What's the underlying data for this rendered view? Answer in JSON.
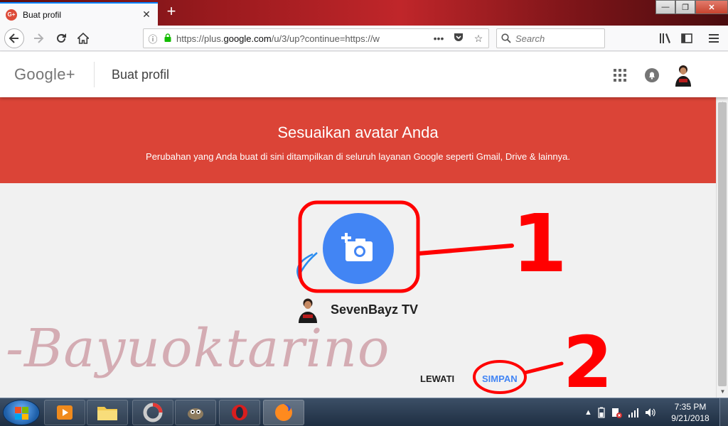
{
  "browser": {
    "tab_title": "Buat profil",
    "tab_favicon": "G+",
    "tab_close": "✕",
    "new_tab": "+",
    "url_domain_prefix": "https://plus.",
    "url_domain": "google.com",
    "url_path": "/u/3/up?continue=https://w",
    "url_more": "•••",
    "search_placeholder": "Search",
    "window": {
      "minimize": "—",
      "maximize": "❐",
      "close": "✕"
    }
  },
  "gplus": {
    "logo": "Google+",
    "page_title": "Buat profil"
  },
  "banner": {
    "title": "Sesuaikan avatar Anda",
    "subtitle": "Perubahan yang Anda buat di sini ditampilkan di seluruh layanan Google seperti Gmail, Drive & lainnya."
  },
  "profile": {
    "name": "SevenBayz TV"
  },
  "actions": {
    "skip_label": "LEWATI",
    "save_label": "SIMPAN"
  },
  "annotations": {
    "label_1": "1",
    "label_2": "2",
    "watermark": "-Bayuoktarino",
    "color": "#ff0000"
  },
  "taskbar": {
    "time": "7:35 PM",
    "date": "9/21/2018"
  },
  "colors": {
    "banner": "#db4437",
    "accent": "#4285f4"
  },
  "icons": [
    "arrow-left-icon",
    "arrow-right-icon",
    "reload-icon",
    "home-icon",
    "info-icon",
    "lock-icon",
    "pocket-icon",
    "star-icon",
    "search-icon",
    "library-icon",
    "sidebar-icon",
    "menu-icon",
    "apps-grid-icon",
    "bell-icon",
    "camera-add-icon"
  ]
}
